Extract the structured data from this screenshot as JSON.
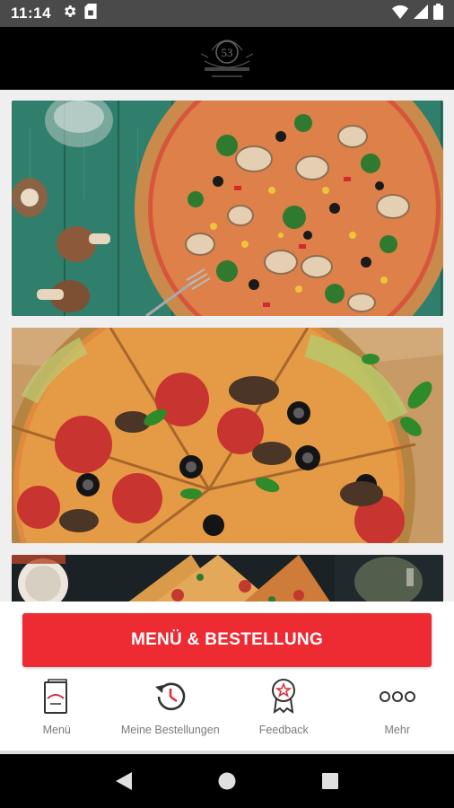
{
  "status_bar": {
    "time": "11:14",
    "left_icons": [
      "gear-icon",
      "sim-card-icon"
    ],
    "right_icons": [
      "wifi-icon",
      "signal-icon",
      "battery-icon"
    ]
  },
  "header": {
    "logo_number": "53",
    "logo_name": "logo"
  },
  "images": [
    {
      "name": "pizza-image-vegetable",
      "description_icon": "pizza-photo"
    },
    {
      "name": "pizza-image-salami",
      "description_icon": "pizza-photo"
    },
    {
      "name": "pizza-image-slices",
      "description_icon": "pizza-photo"
    }
  ],
  "cta": {
    "label": "MENÜ & BESTELLUNG",
    "color": "#ee2b32"
  },
  "bottom_nav": {
    "items": [
      {
        "label": "Menü",
        "icon": "menu-book-icon"
      },
      {
        "label": "Meine Bestellungen",
        "icon": "history-icon"
      },
      {
        "label": "Feedback",
        "icon": "award-ribbon-icon"
      },
      {
        "label": "Mehr",
        "icon": "more-dots-icon"
      }
    ]
  },
  "android_nav": [
    "back-icon",
    "home-icon",
    "recents-icon"
  ]
}
